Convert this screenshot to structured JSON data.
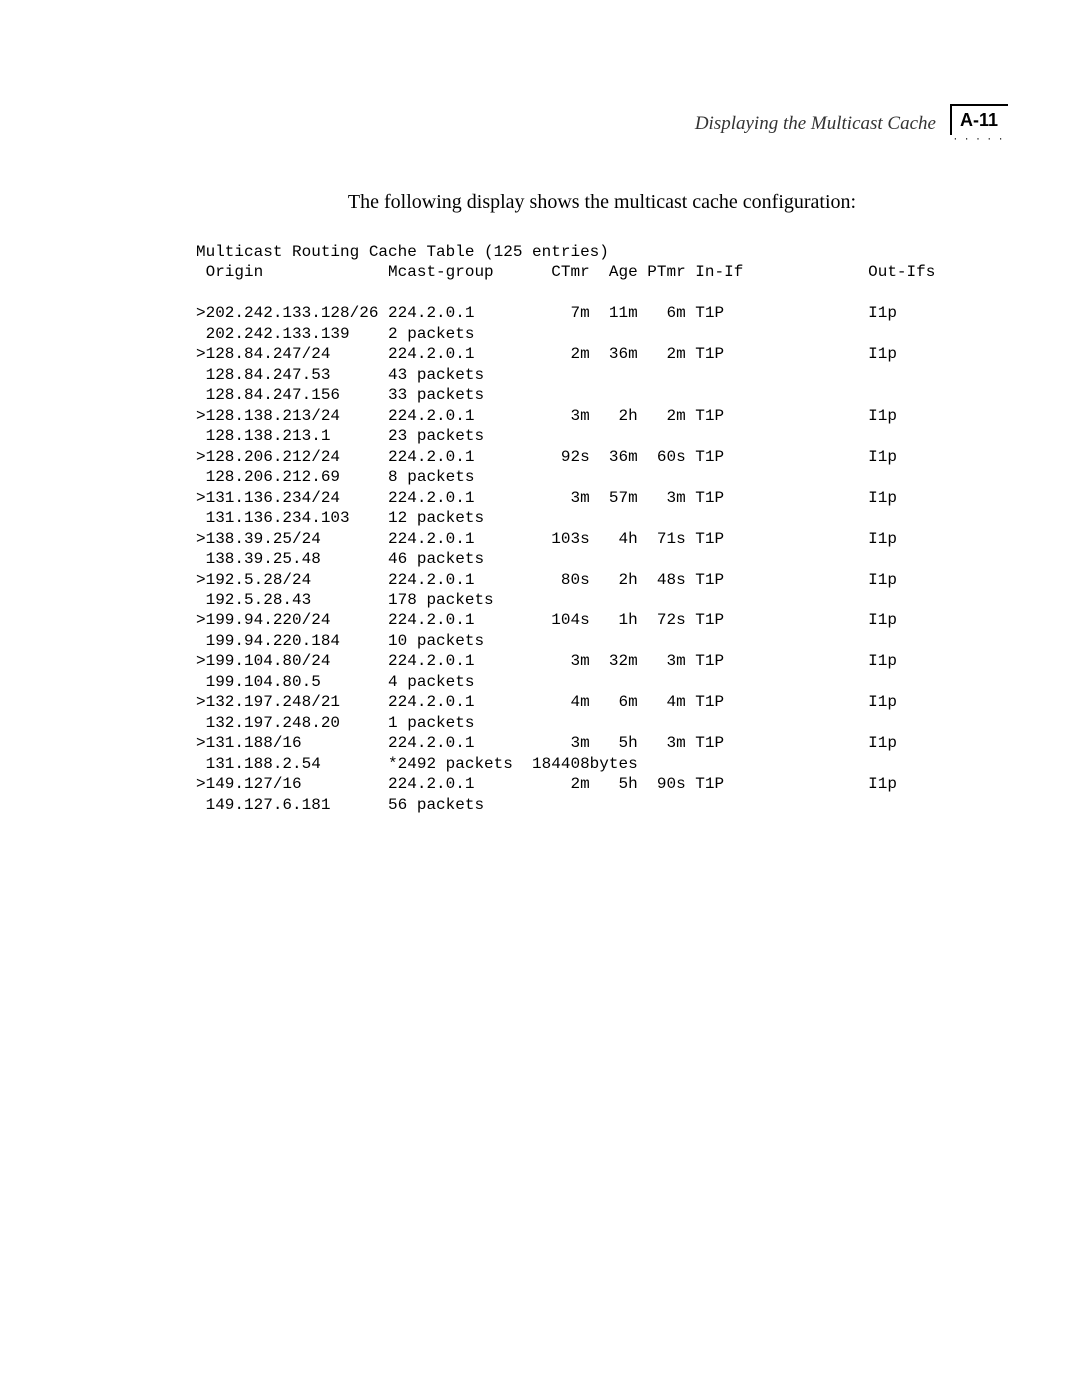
{
  "header": {
    "title": "Displaying the Multicast Cache",
    "page_number": "A-11"
  },
  "intro": "The following display shows the multicast cache configuration:",
  "table": {
    "title": "Multicast Routing Cache Table (125 entries)",
    "columns": {
      "origin": " Origin",
      "mcast": "Mcast-group",
      "ctmr": "CTmr",
      "age": "Age",
      "ptmr": "PTmr",
      "inif": "In-If",
      "outifs": "Out-Ifs"
    },
    "rows": [
      {
        "origin": ">202.242.133.128/26",
        "mcast": "224.2.0.1",
        "ctmr": "7m",
        "age": "11m",
        "ptmr": "6m",
        "inif": "T1P",
        "outifs": "I1p"
      },
      {
        "origin": " 202.242.133.139",
        "mcast": "2 packets"
      },
      {
        "origin": ">128.84.247/24",
        "mcast": "224.2.0.1",
        "ctmr": "2m",
        "age": "36m",
        "ptmr": "2m",
        "inif": "T1P",
        "outifs": "I1p"
      },
      {
        "origin": " 128.84.247.53",
        "mcast": "43 packets"
      },
      {
        "origin": " 128.84.247.156",
        "mcast": "33 packets"
      },
      {
        "origin": ">128.138.213/24",
        "mcast": "224.2.0.1",
        "ctmr": "3m",
        "age": "2h",
        "ptmr": "2m",
        "inif": "T1P",
        "outifs": "I1p"
      },
      {
        "origin": " 128.138.213.1",
        "mcast": "23 packets"
      },
      {
        "origin": ">128.206.212/24",
        "mcast": "224.2.0.1",
        "ctmr": "92s",
        "age": "36m",
        "ptmr": "60s",
        "inif": "T1P",
        "outifs": "I1p"
      },
      {
        "origin": " 128.206.212.69",
        "mcast": "8 packets"
      },
      {
        "origin": ">131.136.234/24",
        "mcast": "224.2.0.1",
        "ctmr": "3m",
        "age": "57m",
        "ptmr": "3m",
        "inif": "T1P",
        "outifs": "I1p"
      },
      {
        "origin": " 131.136.234.103",
        "mcast": "12 packets"
      },
      {
        "origin": ">138.39.25/24",
        "mcast": "224.2.0.1",
        "ctmr": "103s",
        "age": "4h",
        "ptmr": "71s",
        "inif": "T1P",
        "outifs": "I1p"
      },
      {
        "origin": " 138.39.25.48",
        "mcast": "46 packets"
      },
      {
        "origin": ">192.5.28/24",
        "mcast": "224.2.0.1",
        "ctmr": "80s",
        "age": "2h",
        "ptmr": "48s",
        "inif": "T1P",
        "outifs": "I1p"
      },
      {
        "origin": " 192.5.28.43",
        "mcast": "178 packets"
      },
      {
        "origin": ">199.94.220/24",
        "mcast": "224.2.0.1",
        "ctmr": "104s",
        "age": "1h",
        "ptmr": "72s",
        "inif": "T1P",
        "outifs": "I1p"
      },
      {
        "origin": " 199.94.220.184",
        "mcast": "10 packets"
      },
      {
        "origin": ">199.104.80/24",
        "mcast": "224.2.0.1",
        "ctmr": "3m",
        "age": "32m",
        "ptmr": "3m",
        "inif": "T1P",
        "outifs": "I1p"
      },
      {
        "origin": " 199.104.80.5",
        "mcast": "4 packets"
      },
      {
        "origin": ">132.197.248/21",
        "mcast": "224.2.0.1",
        "ctmr": "4m",
        "age": "6m",
        "ptmr": "4m",
        "inif": "T1P",
        "outifs": "I1p"
      },
      {
        "origin": " 132.197.248.20",
        "mcast": "1 packets"
      },
      {
        "origin": ">131.188/16",
        "mcast": "224.2.0.1",
        "ctmr": "3m",
        "age": "5h",
        "ptmr": "3m",
        "inif": "T1P",
        "outifs": "I1p"
      },
      {
        "origin": " 131.188.2.54",
        "mcast": "*2492 packets",
        "ctmr": "184408",
        "age": "bytes"
      },
      {
        "origin": ">149.127/16",
        "mcast": "224.2.0.1",
        "ctmr": "2m",
        "age": "5h",
        "ptmr": "90s",
        "inif": "T1P",
        "outifs": "I1p"
      },
      {
        "origin": " 149.127.6.181",
        "mcast": "56 packets"
      }
    ]
  }
}
